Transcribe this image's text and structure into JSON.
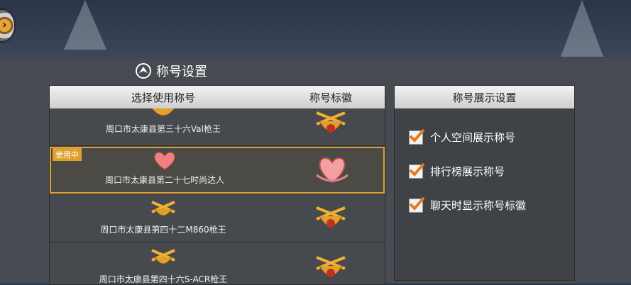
{
  "title": "称号设置",
  "left_panel": {
    "col_title": "选择使用称号",
    "col_badge": "称号标徽",
    "rows": [
      {
        "name": "周口市太康县第三十六Val枪王",
        "active": false
      },
      {
        "name": "周口市太康县第二十七时尚达人",
        "active": true,
        "tag": "使用中"
      },
      {
        "name": "周口市太康县第四十二M860枪王",
        "active": false
      },
      {
        "name": "周口市太康县第四十六S-ACR枪王",
        "active": false
      }
    ]
  },
  "right_panel": {
    "title": "称号展示设置",
    "options": [
      {
        "label": "个人空间展示称号",
        "checked": true
      },
      {
        "label": "排行榜展示称号",
        "checked": true
      },
      {
        "label": "聊天时显示称号标徽",
        "checked": true
      }
    ]
  },
  "icons": {
    "back": "chevron-right-icon",
    "title_logo": "emblem-icon",
    "gun_medal": "crossed-guns-medal-icon",
    "heart_medal": "heart-medal-icon",
    "check": "checkmark-icon"
  },
  "colors": {
    "accent": "#e0a030",
    "check": "#e87a1e"
  }
}
